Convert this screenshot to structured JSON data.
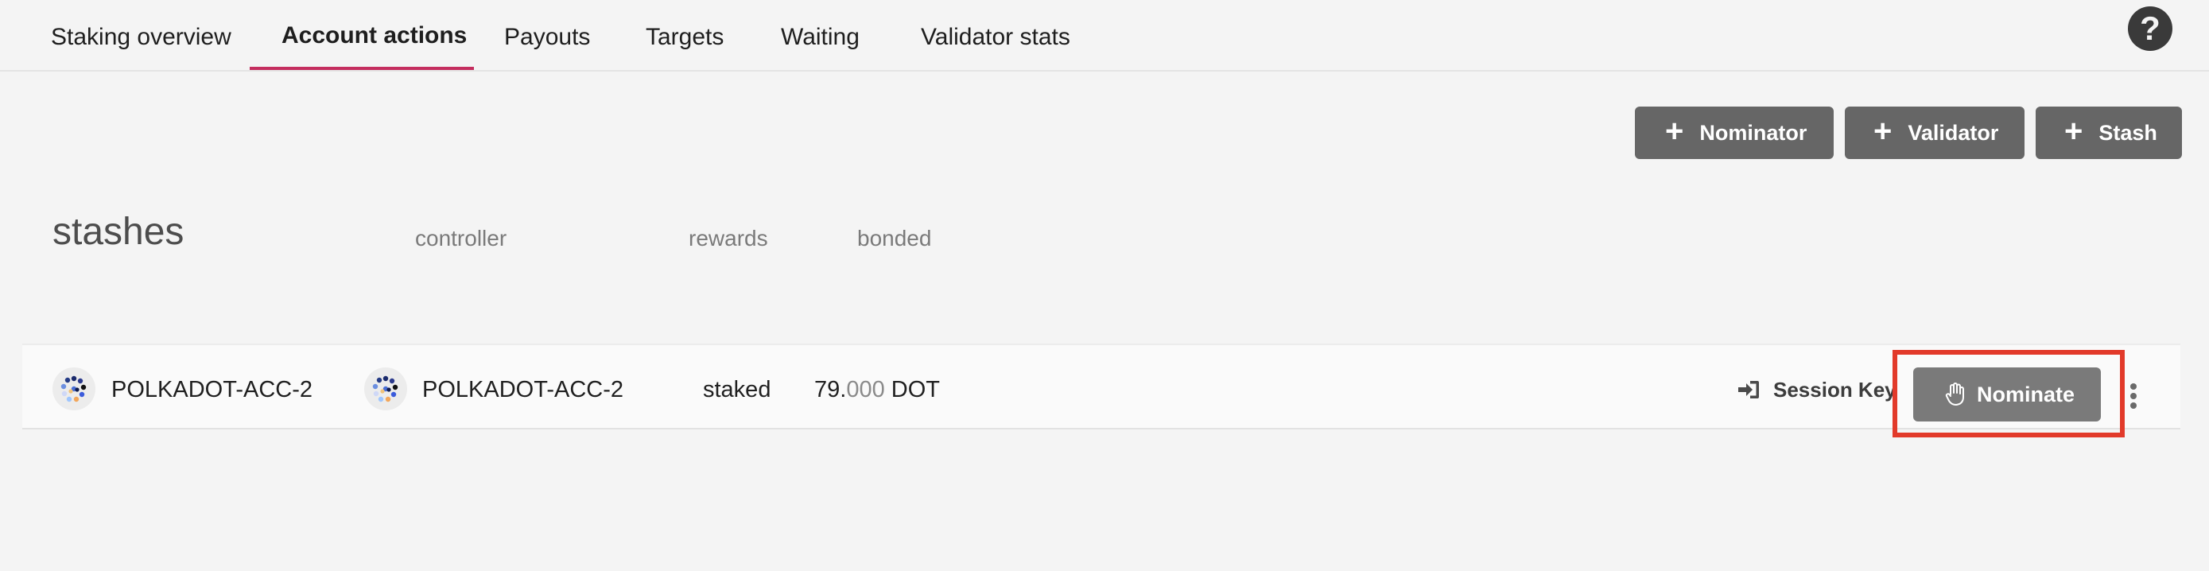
{
  "tabs": [
    {
      "label": "Staking overview",
      "active": false
    },
    {
      "label": "Account actions",
      "active": true
    },
    {
      "label": "Payouts",
      "active": false
    },
    {
      "label": "Targets",
      "active": false
    },
    {
      "label": "Waiting",
      "active": false
    },
    {
      "label": "Validator stats",
      "active": false
    }
  ],
  "help": {
    "glyph": "?"
  },
  "actions": [
    {
      "plus": "+",
      "label": "Nominator"
    },
    {
      "plus": "+",
      "label": "Validator"
    },
    {
      "plus": "+",
      "label": "Stash"
    }
  ],
  "header": {
    "title": "stashes",
    "controller": "controller",
    "rewards": "rewards",
    "bonded": "bonded"
  },
  "row": {
    "stash_name": "POLKADOT-ACC-2",
    "controller_name": "POLKADOT-ACC-2",
    "rewards": "staked",
    "bonded_int": "79.",
    "bonded_dec": "000",
    "bonded_unit": " DOT",
    "session_key_label": "Session Key",
    "nominate_label": "Nominate"
  },
  "icons": {
    "help": "help-icon",
    "plus": "plus-icon",
    "session_key": "sign-in-icon",
    "nominate": "hand-paper-icon",
    "more": "ellipsis-vertical-icon",
    "identicon": "polkadot-identicon"
  },
  "colors": {
    "background": "#f4f4f4",
    "tab_underline": "#c42d5e",
    "button": "#666666",
    "nominate_button": "#7a7a7a",
    "highlight": "#e23a2a"
  }
}
